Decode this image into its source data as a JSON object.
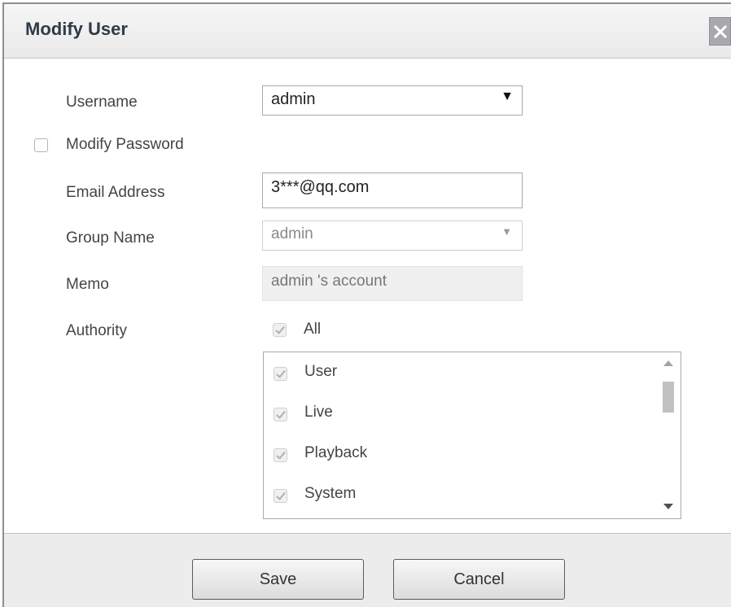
{
  "dialog": {
    "title": "Modify User",
    "close_icon": "close-icon"
  },
  "form": {
    "username": {
      "label": "Username",
      "value": "admin"
    },
    "modify_password": {
      "label": "Modify Password",
      "checked": false
    },
    "email": {
      "label": "Email Address",
      "value": "3***@qq.com"
    },
    "group_name": {
      "label": "Group Name",
      "value": "admin",
      "disabled": true
    },
    "memo": {
      "label": "Memo",
      "value": "admin 's account",
      "readonly": true
    },
    "authority": {
      "label": "Authority",
      "all_label": "All",
      "all_checked": true,
      "items": [
        {
          "label": "User",
          "checked": true
        },
        {
          "label": "Live",
          "checked": true
        },
        {
          "label": "Playback",
          "checked": true
        },
        {
          "label": "System",
          "checked": true
        }
      ]
    }
  },
  "footer": {
    "save_label": "Save",
    "cancel_label": "Cancel"
  },
  "colors": {
    "title_text": "#2f3a47",
    "titlebar_bg": "#ececec",
    "footer_bg": "#ececec",
    "close_bg": "#a7a9ac"
  }
}
